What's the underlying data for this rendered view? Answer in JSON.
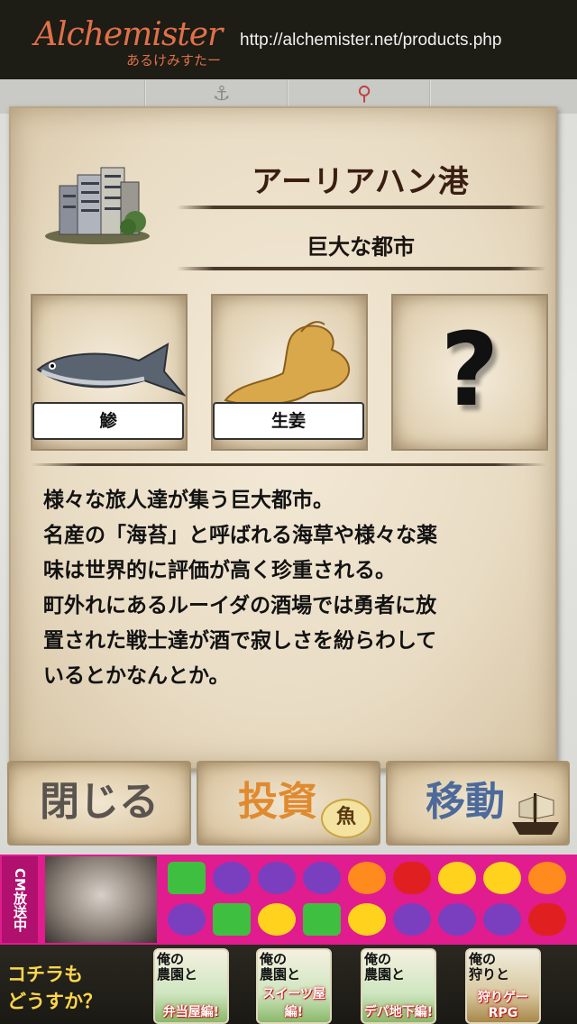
{
  "header": {
    "logo_main": "Alchemister",
    "logo_sub": "あるけみすたー",
    "url": "http://alchemister.net/products.php"
  },
  "place": {
    "name": "アーリアハン港",
    "type": "巨大な都市",
    "icon": "city-buildings-icon"
  },
  "items": [
    {
      "label": "鯵",
      "icon": "fish-icon"
    },
    {
      "label": "生姜",
      "icon": "ginger-icon"
    },
    {
      "label": "",
      "icon": "question-mark-icon"
    }
  ],
  "question_mark": "?",
  "description": [
    "様々な旅人達が集う巨大都市。",
    "名産の「海苔」と呼ばれる海草や様々な薬",
    "味は世界的に評価が高く珍重される。",
    "町外れにあるルーイダの酒場では勇者に放",
    "置された戦士達が酒で寂しさを紛らわして",
    "いるとかなんとか。"
  ],
  "buttons": {
    "close": "閉じる",
    "invest": "投資",
    "invest_badge": "魚",
    "move": "移動"
  },
  "ad": {
    "onair_text": "CM放送中"
  },
  "recommend": {
    "text_line1": "コチラも",
    "text_line2": "どうすか？",
    "apps": [
      {
        "title_top": "俺の",
        "title_mid": "農園と",
        "sub": "弁当屋編!"
      },
      {
        "title_top": "俺の",
        "title_mid": "農園と",
        "sub": "スイーツ屋編!"
      },
      {
        "title_top": "俺の",
        "title_mid": "農園と",
        "sub": "デパ地下編!"
      },
      {
        "title_top": "俺の",
        "title_mid": "狩りと",
        "sub": "狩りゲーRPG"
      }
    ]
  },
  "colors": {
    "parchment": "#e9dcc4",
    "invest_text": "#e08a30",
    "move_text": "#4c6a9a",
    "close_text": "#5a5450",
    "ad_bg": "#e01c8e",
    "logo": "#e07048"
  }
}
